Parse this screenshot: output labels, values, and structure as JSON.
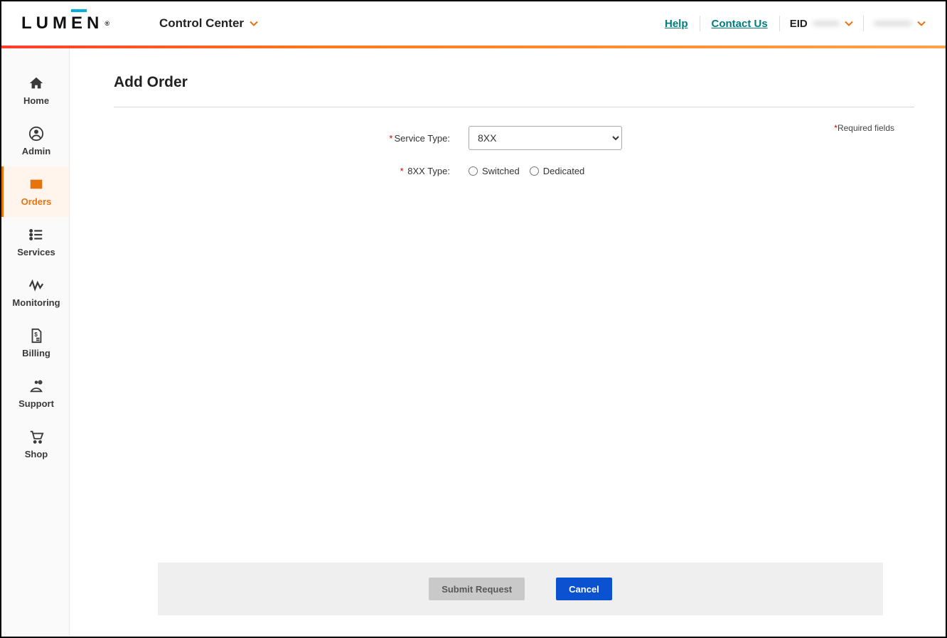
{
  "header": {
    "brand_letters": [
      "L",
      "U",
      "M",
      "E",
      "N"
    ],
    "app_switcher": "Control Center",
    "help": "Help",
    "contact": "Contact Us",
    "eid_label": "EID",
    "eid_value": "•••••••",
    "user_value": "••••••••••"
  },
  "sidebar": {
    "items": [
      {
        "label": "Home",
        "icon": "home"
      },
      {
        "label": "Admin",
        "icon": "user-circle"
      },
      {
        "label": "Orders",
        "icon": "inbox",
        "active": true
      },
      {
        "label": "Services",
        "icon": "list"
      },
      {
        "label": "Monitoring",
        "icon": "activity"
      },
      {
        "label": "Billing",
        "icon": "invoice"
      },
      {
        "label": "Support",
        "icon": "support"
      },
      {
        "label": "Shop",
        "icon": "cart"
      }
    ]
  },
  "page": {
    "title": "Add Order",
    "required_note": "Required fields"
  },
  "form": {
    "service_type_label": "Service Type:",
    "service_type_value": "8XX",
    "xxtype_label": "8XX Type:",
    "radio_switched": "Switched",
    "radio_dedicated": "Dedicated"
  },
  "actions": {
    "submit": "Submit Request",
    "cancel": "Cancel"
  }
}
